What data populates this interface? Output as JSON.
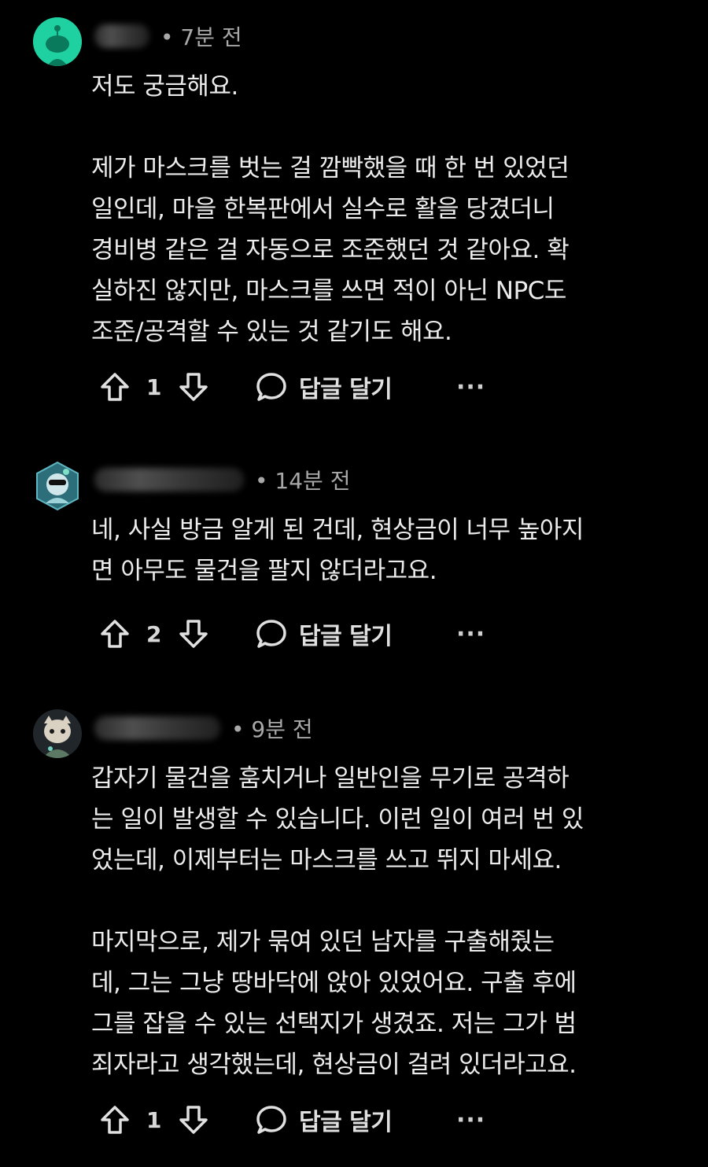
{
  "comments": [
    {
      "time": "• 7분 전",
      "body": "저도 궁금해요.\n\n제가 마스크를 벗는 걸 깜빡했을 때 한 번 있었던\n일인데, 마을 한복판에서 실수로 활을 당겼더니\n경비병 같은 걸 자동으로 조준했던 것 같아요. 확\n실하진 않지만, 마스크를 쓰면 적이 아닌 NPC도\n조준/공격할 수 있는 것 같기도 해요.",
      "votes": "1",
      "reply_label": "답글 달기",
      "more_label": "···"
    },
    {
      "time": "• 14분 전",
      "body": "네, 사실 방금 알게 된 건데, 현상금이 너무 높아지\n면 아무도 물건을 팔지 않더라고요.",
      "votes": "2",
      "reply_label": "답글 달기",
      "more_label": "···"
    },
    {
      "time": "• 9분 전",
      "body": "갑자기 물건을 훔치거나 일반인을 무기로 공격하\n는 일이 발생할 수 있습니다. 이런 일이 여러 번 있\n었는데, 이제부터는 마스크를 쓰고 뛰지 마세요.\n\n마지막으로, 제가 묶여 있던 남자를 구출해줬는\n데, 그는 그냥 땅바닥에 앉아 있었어요. 구출 후에\n그를 잡을 수 있는 선택지가 생겼죠. 저는 그가 범\n죄자라고 생각했는데, 현상금이 걸려 있더라고요.",
      "votes": "1",
      "reply_label": "답글 달기",
      "more_label": "···"
    }
  ],
  "colors": {
    "background": "#000000",
    "text": "#ececec",
    "meta": "#a8a8a8",
    "avatar1": "#1fd1a0"
  },
  "icons": [
    "upvote-icon",
    "downvote-icon",
    "comment-bubble-icon",
    "more-icon"
  ]
}
